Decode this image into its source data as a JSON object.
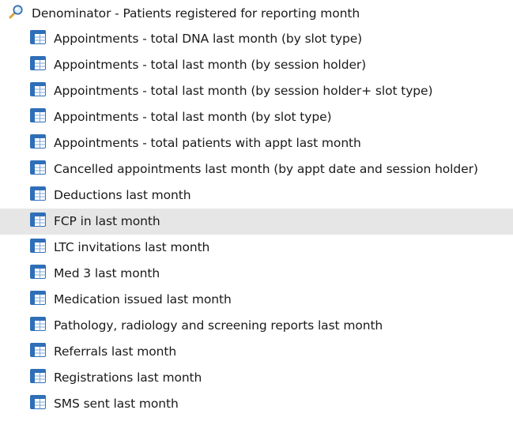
{
  "tree": {
    "root": {
      "label": "Denominator - Patients registered for reporting month",
      "icon": "magnifier-icon"
    },
    "items": [
      {
        "label": "Appointments - total DNA last month (by slot type)",
        "icon": "table-icon",
        "selected": false
      },
      {
        "label": "Appointments - total last month (by session holder)",
        "icon": "table-icon",
        "selected": false
      },
      {
        "label": "Appointments - total last month (by session holder+ slot type)",
        "icon": "table-icon",
        "selected": false
      },
      {
        "label": "Appointments - total last month (by slot type)",
        "icon": "table-icon",
        "selected": false
      },
      {
        "label": "Appointments - total patients with appt last month",
        "icon": "table-icon",
        "selected": false
      },
      {
        "label": "Cancelled appointments last month (by appt date and session holder)",
        "icon": "table-icon",
        "selected": false
      },
      {
        "label": "Deductions last month",
        "icon": "table-icon",
        "selected": false
      },
      {
        "label": "FCP in last month",
        "icon": "table-icon",
        "selected": true
      },
      {
        "label": "LTC invitations last month",
        "icon": "table-icon",
        "selected": false
      },
      {
        "label": "Med 3 last month",
        "icon": "table-icon",
        "selected": false
      },
      {
        "label": "Medication issued last month",
        "icon": "table-icon",
        "selected": false
      },
      {
        "label": "Pathology, radiology and screening reports last month",
        "icon": "table-icon",
        "selected": false
      },
      {
        "label": "Referrals last month",
        "icon": "table-icon",
        "selected": false
      },
      {
        "label": "Registrations last month",
        "icon": "table-icon",
        "selected": false
      },
      {
        "label": "SMS sent last month",
        "icon": "table-icon",
        "selected": false
      }
    ]
  },
  "colors": {
    "selection_bg": "#e6e6e6",
    "table_icon_blue": "#2f6fb8",
    "magnifier_ring": "#3a6fb0"
  }
}
